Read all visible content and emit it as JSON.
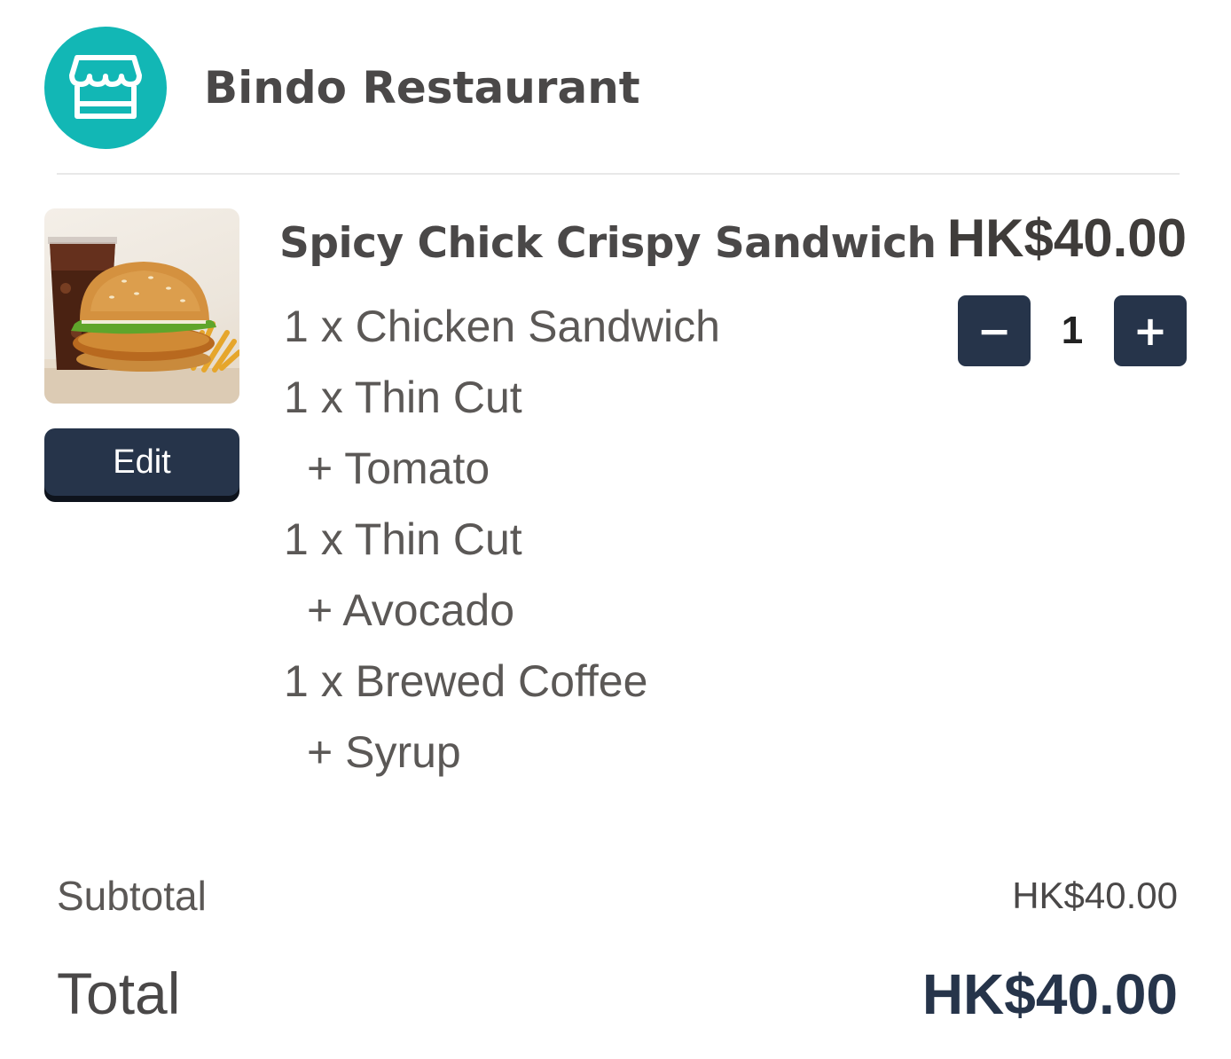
{
  "store": {
    "name": "Bindo Restaurant",
    "icon": "store-icon",
    "accent_color": "#12b7b5"
  },
  "cart_item": {
    "name": "Spicy Chick Crispy Sandwich",
    "price": "HK$40.00",
    "edit_label": "Edit",
    "quantity": "1",
    "decrement_label": "−",
    "increment_label": "+",
    "button_color": "#26344a",
    "modifiers": [
      "1 x Chicken Sandwich",
      "1 x Thin Cut",
      "+ Tomato",
      "1 x Thin Cut",
      "+ Avocado",
      "1 x Brewed Coffee",
      "+ Syrup"
    ]
  },
  "summary": {
    "subtotal_label": "Subtotal",
    "subtotal_value": "HK$40.00",
    "total_label": "Total",
    "total_value": "HK$40.00"
  }
}
